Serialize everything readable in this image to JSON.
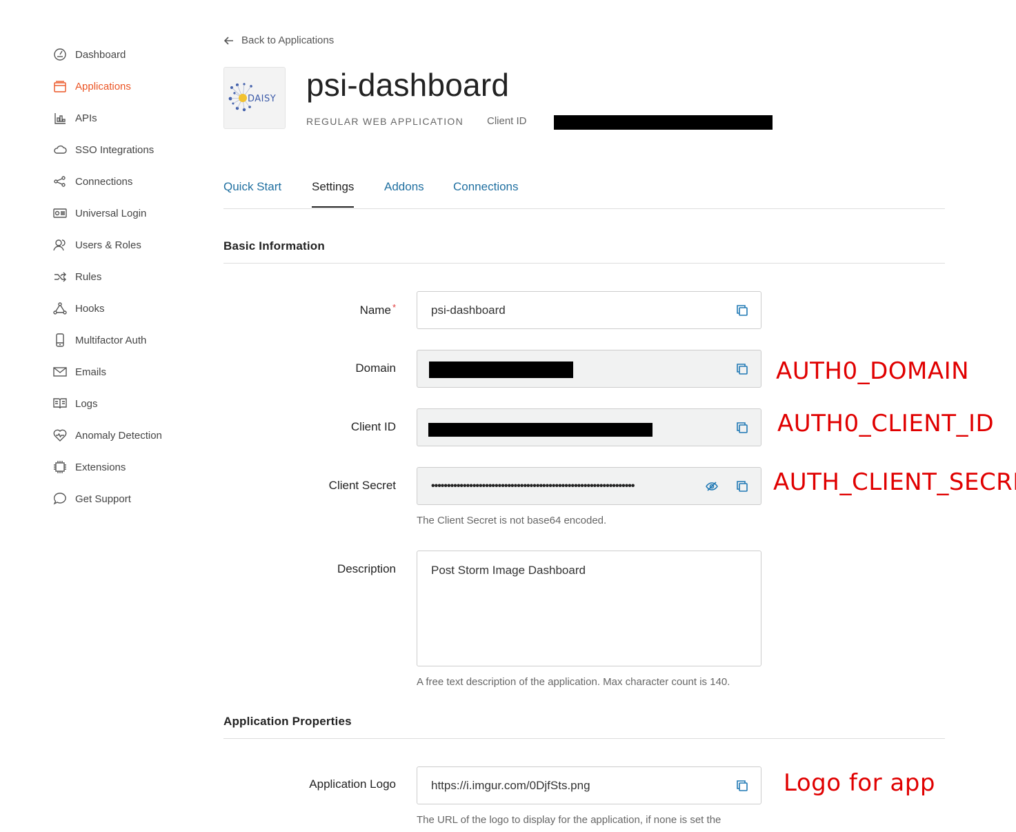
{
  "sidebar": {
    "items": [
      {
        "label": "Dashboard",
        "icon": "dashboard-icon"
      },
      {
        "label": "Applications",
        "icon": "applications-icon",
        "active": true
      },
      {
        "label": "APIs",
        "icon": "apis-icon"
      },
      {
        "label": "SSO Integrations",
        "icon": "cloud-icon"
      },
      {
        "label": "Connections",
        "icon": "connections-icon"
      },
      {
        "label": "Universal Login",
        "icon": "login-icon"
      },
      {
        "label": "Users & Roles",
        "icon": "users-icon"
      },
      {
        "label": "Rules",
        "icon": "rules-icon"
      },
      {
        "label": "Hooks",
        "icon": "hooks-icon"
      },
      {
        "label": "Multifactor Auth",
        "icon": "phone-icon"
      },
      {
        "label": "Emails",
        "icon": "mail-icon"
      },
      {
        "label": "Logs",
        "icon": "logs-icon"
      },
      {
        "label": "Anomaly Detection",
        "icon": "heart-icon"
      },
      {
        "label": "Extensions",
        "icon": "chip-icon"
      },
      {
        "label": "Get Support",
        "icon": "chat-icon"
      }
    ]
  },
  "header": {
    "back_label": "Back to Applications",
    "logo_text": "DAISY",
    "title": "psi-dashboard",
    "app_type": "REGULAR WEB APPLICATION",
    "client_id_label": "Client ID"
  },
  "tabs": [
    {
      "label": "Quick Start"
    },
    {
      "label": "Settings",
      "active": true
    },
    {
      "label": "Addons"
    },
    {
      "label": "Connections"
    }
  ],
  "basic_info": {
    "title": "Basic Information",
    "name_label": "Name",
    "name_required": "*",
    "name_value": "psi-dashboard",
    "domain_label": "Domain",
    "client_id_label": "Client ID",
    "client_secret_label": "Client Secret",
    "client_secret_value": "••••••••••••••••••••••••••••••••••••••••••••••••••••••••••••••••",
    "client_secret_hint": "The Client Secret is not base64 encoded.",
    "description_label": "Description",
    "description_value": "Post Storm Image Dashboard",
    "description_hint": "A free text description of the application. Max character count is 140."
  },
  "app_properties": {
    "title": "Application Properties",
    "logo_label": "Application Logo",
    "logo_value": "https://i.imgur.com/0DjfSts.png",
    "logo_hint": "The URL of the logo to display for the application, if none is set the"
  },
  "annotations": {
    "domain": "AUTH0_DOMAIN",
    "client_id": "AUTH0_CLIENT_ID",
    "client_secret": "AUTH_CLIENT_SECRET",
    "logo": "Logo for app"
  },
  "colors": {
    "accent": "#eb5424",
    "link": "#1f6fa0",
    "annotation": "#e00000"
  }
}
